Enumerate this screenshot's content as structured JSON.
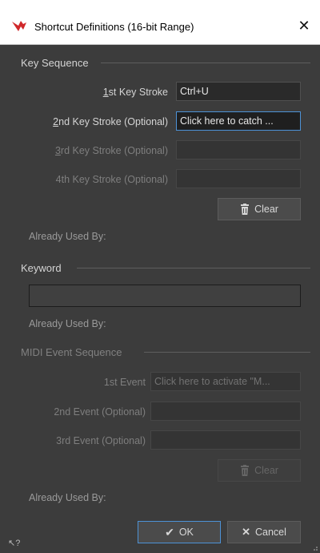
{
  "window": {
    "title": "Shortcut Definitions (16-bit Range)",
    "close_glyph": "✕",
    "app_icon": "app-logo-icon",
    "accent_color": "#4d92d6"
  },
  "key_sequence": {
    "heading": "Key Sequence",
    "stroke1": {
      "label_mn": "1",
      "label_rest": "st Key Stroke",
      "value": "Ctrl+U"
    },
    "stroke2": {
      "label_mn": "2",
      "label_rest": "nd Key Stroke (Optional)",
      "value": "Click here to catch ..."
    },
    "stroke3": {
      "label_mn": "3",
      "label_rest": "rd Key Stroke (Optional)",
      "value": ""
    },
    "stroke4": {
      "label": "4th Key Stroke (Optional)",
      "value": ""
    },
    "clear_label": "Clear",
    "already_used": "Already Used By:"
  },
  "keyword": {
    "heading": "Keyword",
    "value": "",
    "already_used": "Already Used By:"
  },
  "midi": {
    "heading": "MIDI Event Sequence",
    "event1": {
      "label": "1st Event",
      "value": "Click here to activate \"M..."
    },
    "event2": {
      "label": "2nd Event (Optional)",
      "value": ""
    },
    "event3": {
      "label": "3rd Event (Optional)",
      "value": ""
    },
    "clear_label": "Clear",
    "already_used": "Already Used By:"
  },
  "footer": {
    "ok_label": "OK",
    "cancel_label": "Cancel",
    "ok_glyph": "✔",
    "cancel_glyph": "✕",
    "help_glyph": "↖?"
  }
}
